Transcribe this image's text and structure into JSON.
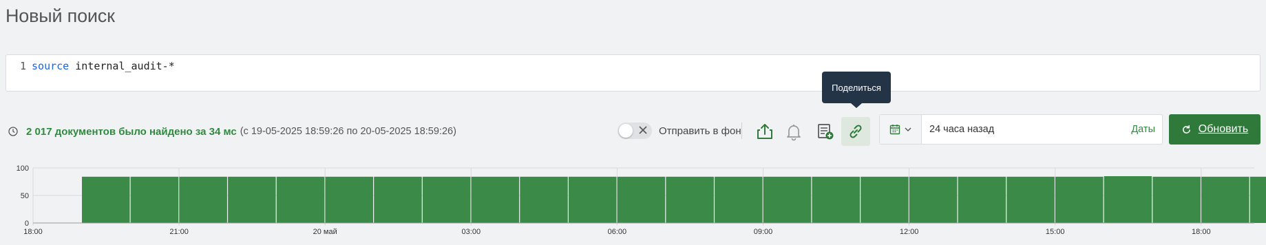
{
  "page": {
    "title": "Новый поиск"
  },
  "query": {
    "line_number": "1",
    "keyword": "source",
    "argument": "internal_audit-*"
  },
  "tooltip": {
    "text": "Поделиться"
  },
  "status": {
    "found_text": "2 017 документов было найдено за 34 мс",
    "range_text": "(с 19-05-2025 18:59:26 по 20-05-2025 18:59:26)"
  },
  "toolbar": {
    "background_label": "Отправить в фон",
    "background_enabled": false,
    "icons": [
      "share-upload-icon",
      "bell-icon",
      "add-report-icon",
      "link-icon"
    ],
    "active_icon": "link-icon"
  },
  "period": {
    "value": "24 часа назад",
    "dates_label": "Даты"
  },
  "refresh": {
    "label": "Обновить"
  },
  "colors": {
    "accent": "#2f7a3a",
    "bar": "#3c8a48",
    "link": "#2f8a3f"
  },
  "chart_data": {
    "type": "bar",
    "ylim": [
      0,
      100
    ],
    "yticks": [
      "0",
      "50",
      "100"
    ],
    "xticks": [
      "18:00",
      "21:00",
      "20 май",
      "03:00",
      "06:00",
      "09:00",
      "12:00",
      "15:00",
      "18:00"
    ],
    "grid": true,
    "values": [
      84,
      84,
      84,
      84,
      84,
      84,
      84,
      84,
      84,
      84,
      84,
      84,
      84,
      84,
      84,
      84,
      84,
      84,
      84,
      84,
      84,
      85,
      84,
      84,
      84
    ]
  }
}
